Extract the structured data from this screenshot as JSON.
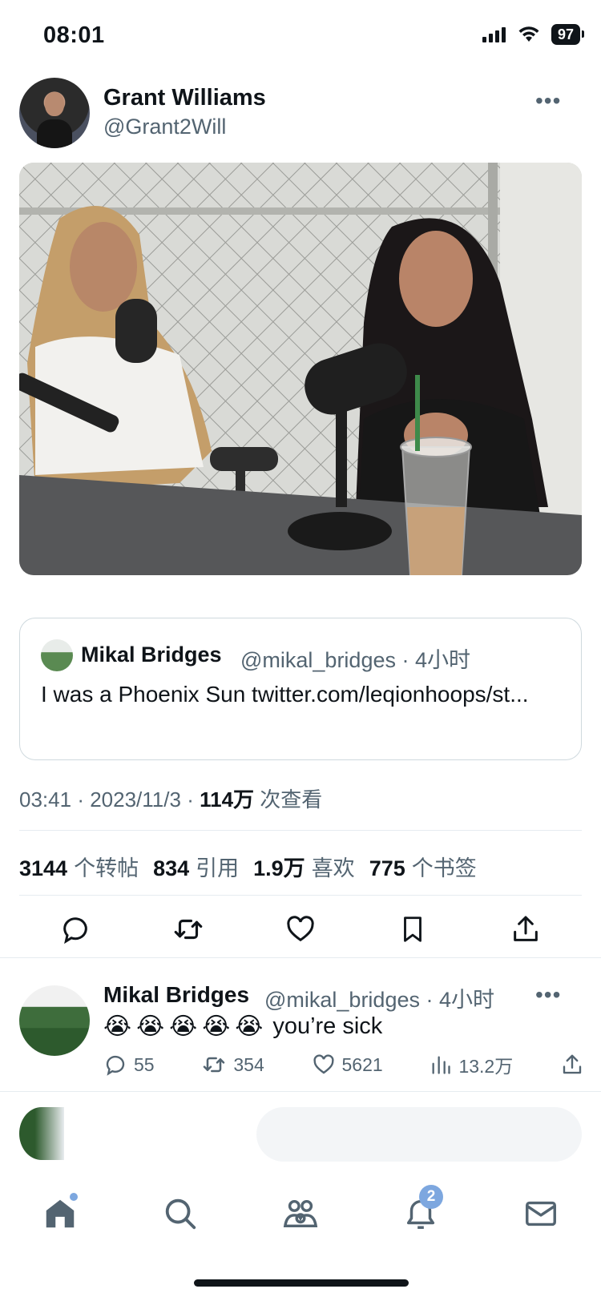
{
  "status_bar": {
    "time": "08:01",
    "battery": "97"
  },
  "tweet": {
    "author_name": "Grant Williams",
    "author_handle": "@Grant2Will",
    "more": "•••",
    "quote": {
      "name": "Mikal Bridges",
      "handle_time": "@mikal_bridges · 4小时",
      "text": "I was a Phoenix Sun twitter.com/leqionhoops/st..."
    },
    "meta": {
      "time": "03:41",
      "date": "2023/11/3",
      "views": "114万",
      "views_label": "次查看"
    },
    "stats": {
      "retweets": "3144",
      "retweets_label": "个转帖",
      "quotes": "834",
      "quotes_label": "引用",
      "likes": "1.9万",
      "likes_label": "喜欢",
      "bookmarks": "775",
      "bookmarks_label": "个书签"
    }
  },
  "reply": {
    "name": "Mikal Bridges",
    "handle_time": "@mikal_bridges · 4小时",
    "emojis": [
      "😭",
      "😭",
      "😭",
      "😭",
      "😭"
    ],
    "text": "you’re sick",
    "replies": "55",
    "retweets": "354",
    "likes": "5621",
    "views": "13.2万"
  },
  "nav": {
    "notifications_badge": "2"
  },
  "icons": {
    "reply": "reply-icon",
    "retweet": "retweet-icon",
    "like": "heart-icon",
    "bookmark": "bookmark-icon",
    "share": "share-icon",
    "views": "views-icon",
    "home": "home-icon",
    "search": "search-icon",
    "communities": "communities-icon",
    "notifications": "bell-icon",
    "messages": "mail-icon"
  },
  "colors": {
    "text": "#0f1419",
    "secondary": "#536471",
    "badge": "#7da7df",
    "border": "#cfd9de"
  }
}
